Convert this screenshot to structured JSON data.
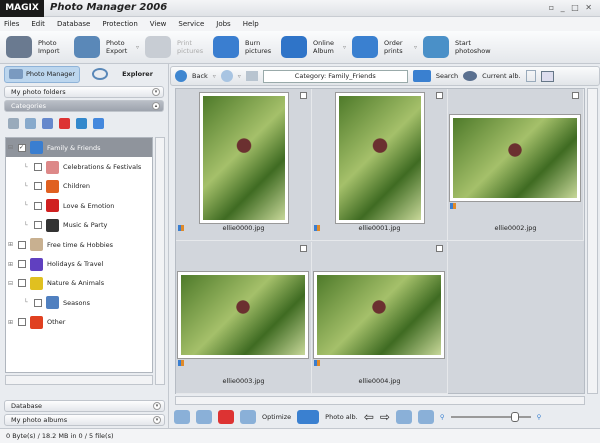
{
  "window": {
    "logo": "MAGIX",
    "title": "Photo Manager 2006",
    "controls": "▫ _ □ ✕"
  },
  "menu": [
    "Files",
    "Edit",
    "Database",
    "Protection",
    "View",
    "Service",
    "Jobs",
    "Help"
  ],
  "toolbar": [
    {
      "label": "Photo Import",
      "color": "#6a7a90",
      "dd": false
    },
    {
      "label": "Photo Export",
      "color": "#5a88b8",
      "dd": true
    },
    {
      "label": "Print pictures",
      "color": "#c8cdd4",
      "dd": false,
      "disabled": true
    },
    {
      "label": "Burn pictures",
      "color": "#3a7ed0",
      "dd": false
    },
    {
      "label": "Online Album",
      "color": "#2f74c8",
      "dd": true
    },
    {
      "label": "Order prints",
      "color": "#3a80d0",
      "dd": true
    },
    {
      "label": "Start photoshow",
      "color": "#4a90c8",
      "dd": false
    }
  ],
  "left": {
    "tabs": [
      "Photo Manager",
      "Explorer"
    ],
    "sections": {
      "folders": "My photo folders",
      "categories": "Categories",
      "database": "Database",
      "albums": "My photo albums"
    },
    "tree": [
      {
        "label": "Family & Friends",
        "level": 0,
        "checked": true,
        "selected": true,
        "exp": "⊟",
        "color": "#3a7ed0"
      },
      {
        "label": "Celebrations & Festivals",
        "level": 1,
        "color": "#d88"
      },
      {
        "label": "Children",
        "level": 1,
        "color": "#e06020"
      },
      {
        "label": "Love & Emotion",
        "level": 1,
        "color": "#d02020"
      },
      {
        "label": "Music & Party",
        "level": 1,
        "color": "#333"
      },
      {
        "label": "Free time & Hobbies",
        "level": 0,
        "exp": "⊞",
        "color": "#c8b090"
      },
      {
        "label": "Holidays & Travel",
        "level": 0,
        "exp": "⊞",
        "color": "#6040c0"
      },
      {
        "label": "Nature & Animals",
        "level": 0,
        "exp": "⊟",
        "color": "#e0c020"
      },
      {
        "label": "Seasons",
        "level": 1,
        "color": "#5080c0"
      },
      {
        "label": "Other",
        "level": 0,
        "exp": "⊞",
        "color": "#e04020"
      }
    ]
  },
  "nav": {
    "back": "Back",
    "category": "Category: Family_Friends",
    "search": "Search",
    "current": "Current alb."
  },
  "photos": [
    "ellie0000.jpg",
    "ellie0001.jpg",
    "ellie0002.jpg",
    "ellie0003.jpg",
    "ellie0004.jpg"
  ],
  "bottom": {
    "optimize": "Optimize",
    "album": "Photo alb."
  },
  "status": "0 Byte(s) / 18.2 MB in 0 / 5 file(s)"
}
